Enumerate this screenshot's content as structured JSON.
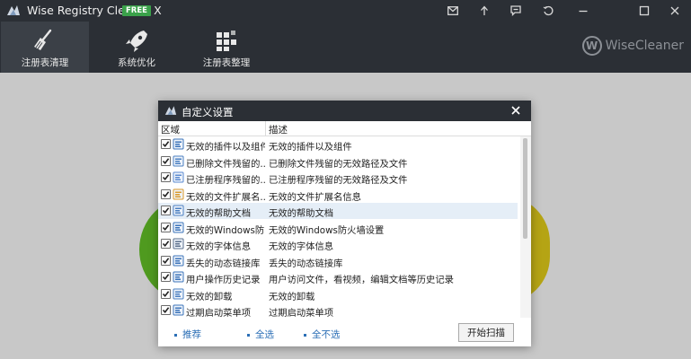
{
  "app": {
    "title": "Wise Registry Cleaner X",
    "badge": "FREE"
  },
  "toolbar": {
    "tabs": [
      {
        "label": "注册表清理",
        "icon": "broom-icon"
      },
      {
        "label": "系统优化",
        "icon": "rocket-icon"
      },
      {
        "label": "注册表整理",
        "icon": "defrag-grid-icon"
      }
    ],
    "brand": "WiseCleaner",
    "brand_letter": "W"
  },
  "title_icons": [
    "mail-icon",
    "upload-icon",
    "chat-icon",
    "restore-icon",
    "minimize-icon",
    "maximize-icon",
    "close-icon"
  ],
  "dialog": {
    "title": "自定义设置",
    "columns": {
      "area": "区域",
      "description": "描述"
    },
    "rows": [
      {
        "area": "无效的插件以及组件",
        "description": "无效的插件以及组件",
        "checked": true,
        "icon": "component-icon"
      },
      {
        "area": "已删除文件残留的...",
        "description": "已删除文件残留的无效路径及文件",
        "checked": true,
        "icon": "file-list-icon"
      },
      {
        "area": "已注册程序残留的...",
        "description": "已注册程序残留的无效路径及文件",
        "checked": true,
        "icon": "program-window-icon"
      },
      {
        "area": "无效的文件扩展名...",
        "description": "无效的文件扩展名信息",
        "checked": true,
        "icon": "file-extension-icon"
      },
      {
        "area": "无效的帮助文档",
        "description": "无效的帮助文档",
        "checked": true,
        "icon": "help-document-icon"
      },
      {
        "area": "无效的Windows防...",
        "description": "无效的Windows防火墙设置",
        "checked": true,
        "icon": "firewall-icon"
      },
      {
        "area": "无效的字体信息",
        "description": "无效的字体信息",
        "checked": true,
        "icon": "font-icon"
      },
      {
        "area": "丢失的动态链接库",
        "description": "丢失的动态链接库",
        "checked": true,
        "icon": "dll-icon"
      },
      {
        "area": "用户操作历史记录",
        "description": "用户访问文件，看视频，编辑文档等历史记录",
        "checked": true,
        "icon": "history-clock-icon"
      },
      {
        "area": "无效的卸载",
        "description": "无效的卸载",
        "checked": true,
        "icon": "uninstall-icon"
      },
      {
        "area": "过期启动菜单项",
        "description": "过期启动菜单项",
        "checked": true,
        "icon": "start-menu-icon"
      }
    ],
    "selected_index": 4,
    "footer": {
      "recommend": "推荐",
      "select_all": "全选",
      "select_none": "全不选",
      "scan": "开始扫描"
    }
  },
  "colors": {
    "titlebar": "#2b2f35",
    "accent_green": "#3aa14a",
    "link_blue": "#2c6fb6",
    "selected_row": "#e5eef7"
  }
}
